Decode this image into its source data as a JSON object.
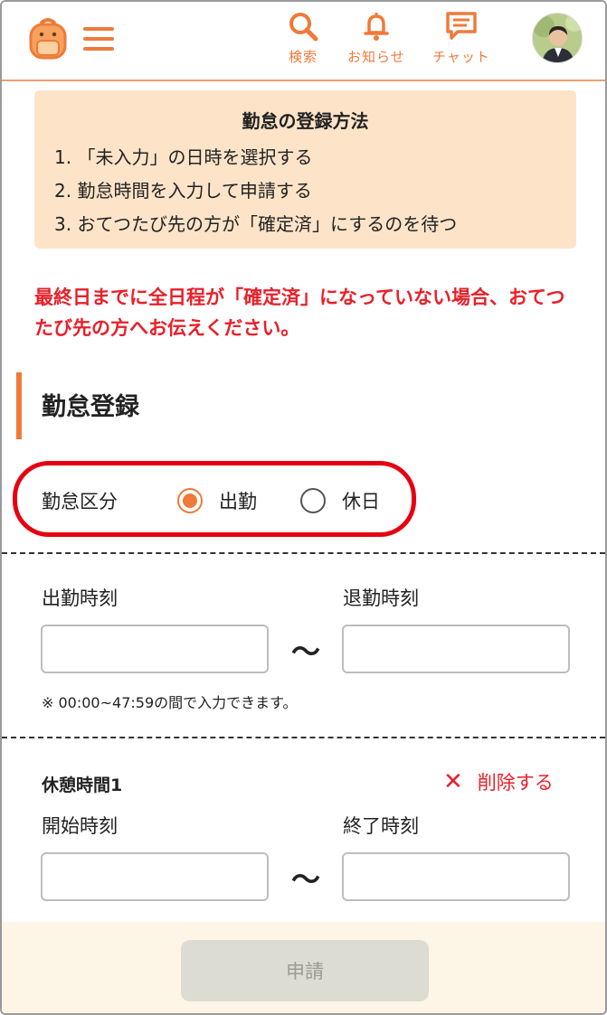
{
  "header": {
    "nav": [
      {
        "label": "検索",
        "icon": "search-icon"
      },
      {
        "label": "お知らせ",
        "icon": "bell-icon"
      },
      {
        "label": "チャット",
        "icon": "chat-icon"
      }
    ],
    "accent_color": "#ef7a3a"
  },
  "howto": {
    "title": "勤怠の登録方法",
    "steps": [
      "1.  「未入力」の日時を選択する",
      "2.  勤怠時間を入力して申請する",
      "3.  おてつたび先の方が「確定済」にするのを待つ"
    ]
  },
  "warning": "最終日までに全日程が「確定済」になっていない場合、おてつたび先の方へお伝えください。",
  "section": {
    "title": "勤怠登録"
  },
  "attendance_type": {
    "label": "勤怠区分",
    "options": [
      {
        "label": "出勤",
        "selected": true
      },
      {
        "label": "休日",
        "selected": false
      }
    ]
  },
  "work_time": {
    "start_label": "出勤時刻",
    "end_label": "退勤時刻",
    "start_value": "",
    "end_value": "",
    "separator": "～",
    "note": "※ 00:00~47:59の間で入力できます。"
  },
  "break": {
    "title": "休憩時間1",
    "delete_label": "削除する",
    "start_label": "開始時刻",
    "end_label": "終了時刻",
    "start_value": "",
    "end_value": "",
    "separator": "～"
  },
  "footer": {
    "submit_label": "申請"
  }
}
